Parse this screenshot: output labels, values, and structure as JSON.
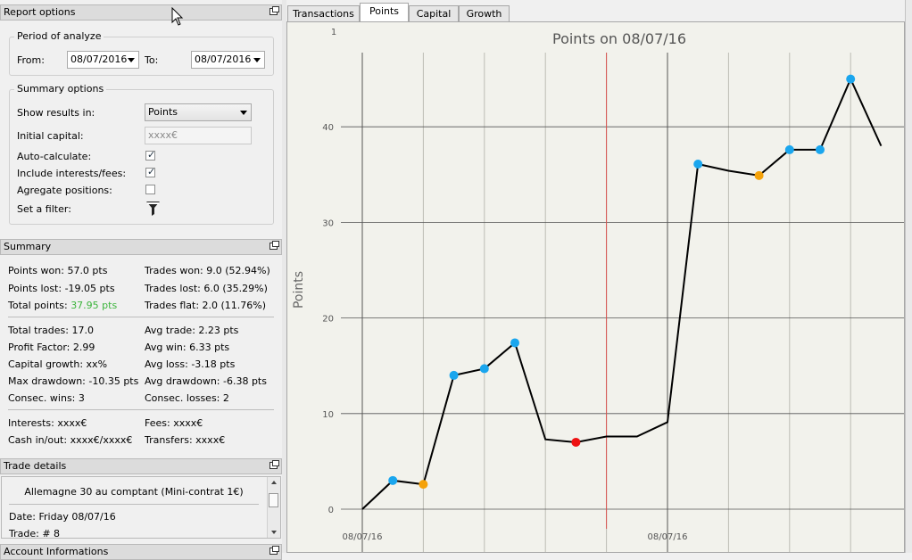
{
  "report_options": {
    "title": "Report options",
    "period": {
      "title": "Period of analyze",
      "from_label": "From:",
      "from_value": "08/07/2016",
      "to_label": "To:",
      "to_value": "08/07/2016"
    },
    "summary_options": {
      "title": "Summary options",
      "show_results_label": "Show results in:",
      "show_results_value": "Points",
      "initial_capital_label": "Initial capital:",
      "initial_capital_placeholder": "xxxx€",
      "auto_calculate_label": "Auto-calculate:",
      "auto_calculate_checked": true,
      "include_interests_label": "Include interests/fees:",
      "include_interests_checked": true,
      "aggregate_label": "Agregate positions:",
      "aggregate_checked": false,
      "filter_label": "Set a filter:",
      "filter_icon": "funnel-icon"
    }
  },
  "summary": {
    "title": "Summary",
    "points_won": "Points won: 57.0 pts",
    "trades_won": "Trades won: 9.0 (52.94%)",
    "points_lost": "Points lost: -19.05 pts",
    "trades_lost": "Trades lost: 6.0 (35.29%)",
    "total_points_label": "Total points:",
    "total_points_value": "37.95 pts",
    "total_points_color": "#3cb43c",
    "trades_flat": "Trades flat: 2.0 (11.76%)",
    "total_trades": "Total trades: 17.0",
    "avg_trade": "Avg trade: 2.23 pts",
    "profit_factor": "Profit Factor: 2.99",
    "avg_win": "Avg win: 6.33 pts",
    "capital_growth": "Capital growth: xx%",
    "avg_loss": "Avg loss: -3.18 pts",
    "max_drawdown": "Max drawdown: -10.35 pts",
    "avg_drawdown": "Avg drawdown: -6.38 pts",
    "consec_wins": "Consec. wins: 3",
    "consec_losses": "Consec. losses: 2",
    "interests": "Interests: xxxx€",
    "fees": "Fees: xxxx€",
    "cash_inout": "Cash in/out: xxxx€/xxxx€",
    "transfers": "Transfers: xxxx€"
  },
  "trade_details": {
    "title": "Trade details",
    "instrument": "Allemagne 30 au comptant (Mini-contrat 1€)",
    "date": "Date: Friday 08/07/16",
    "trade": "Trade: # 8"
  },
  "account_info": {
    "title": "Account Informations"
  },
  "tabs": [
    {
      "label": "Transactions",
      "active": false
    },
    {
      "label": "Points",
      "active": true
    },
    {
      "label": "Capital",
      "active": false
    },
    {
      "label": "Growth",
      "active": false
    }
  ],
  "chart_data": {
    "type": "line",
    "title": "Points on 08/07/16",
    "ylabel": "Points",
    "xlabel": "",
    "ylim": [
      -2,
      48
    ],
    "yticks": [
      0,
      10,
      20,
      30,
      40
    ],
    "x_tick_labels": [
      "08/07/16",
      "08/07/16"
    ],
    "top_label": "1",
    "grid": true,
    "trades": [
      1,
      2,
      3,
      4,
      5,
      6,
      7,
      8,
      9,
      10,
      11,
      12,
      13,
      14,
      15,
      16,
      17,
      18
    ],
    "values": [
      0,
      3.0,
      2.6,
      14.0,
      14.7,
      17.4,
      7.3,
      7.0,
      7.6,
      7.6,
      9.1,
      36.1,
      35.4,
      34.9,
      37.6,
      37.6,
      45.0,
      38.0
    ],
    "marker_kinds": [
      "none",
      "win",
      "flat",
      "win",
      "win",
      "win",
      "none",
      "loss",
      "none",
      "none",
      "none",
      "win",
      "none",
      "flat",
      "win",
      "win",
      "win",
      "none"
    ],
    "colors": {
      "win": "#1aa6ee",
      "flat": "#f5a20a",
      "loss": "#ee1111",
      "line": "#000000",
      "current_trade_line": "#d9534f"
    },
    "current_trade": 9
  }
}
